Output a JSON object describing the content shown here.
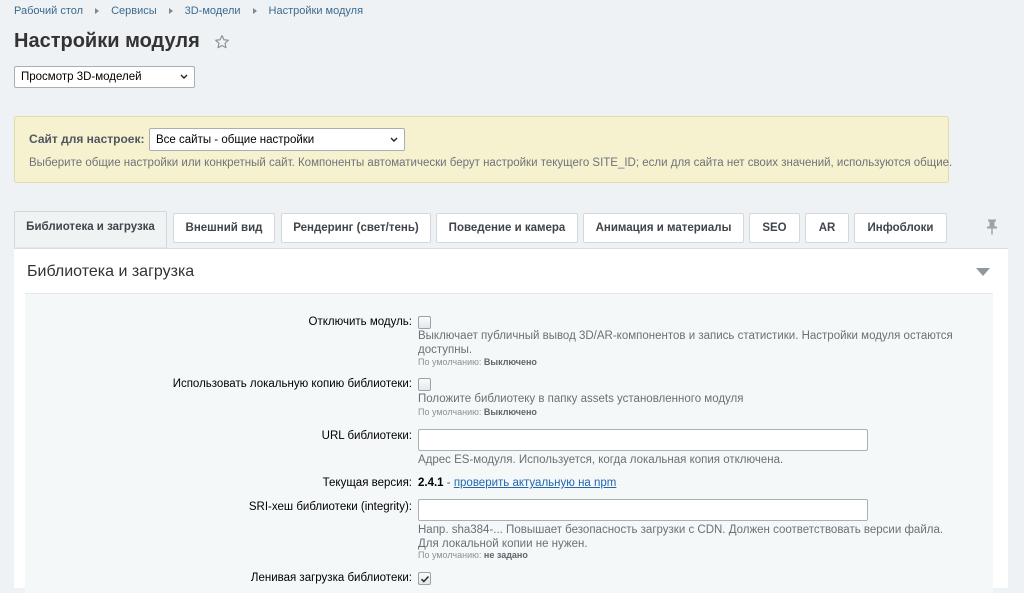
{
  "breadcrumb": [
    "Рабочий стол",
    "Сервисы",
    "3D-модели",
    "Настройки модуля"
  ],
  "page": {
    "title": "Настройки модуля"
  },
  "module_select": {
    "value": "Просмотр 3D-моделей"
  },
  "site": {
    "label": "Сайт для настроек:",
    "value": "Все сайты - общие настройки",
    "hint": "Выберите общие настройки или конкретный сайт. Компоненты автоматически берут настройки текущего SITE_ID; если для сайта нет своих значений, используются общие."
  },
  "tabs": [
    "Библиотека и загрузка",
    "Внешний вид",
    "Рендеринг (свет/тень)",
    "Поведение и камера",
    "Анимация и материалы",
    "SEO",
    "AR",
    "Инфоблоки"
  ],
  "section": {
    "title": "Библиотека и загрузка"
  },
  "fields": {
    "disable": {
      "label": "Отключить модуль:",
      "desc": "Выключает публичный вывод 3D/AR-компонентов и запись статистики. Настройки модуля остаются доступны.",
      "default_label": "По умолчанию:",
      "default_value": "Выключено"
    },
    "local_copy": {
      "label": "Использовать локальную копию библиотеки:",
      "desc": "Положите библиотеку в папку assets установленного модуля",
      "default_label": "По умолчанию:",
      "default_value": "Выключено"
    },
    "url": {
      "label": "URL библиотеки:",
      "value": "",
      "desc": "Адрес ES-модуля. Используется, когда локальная копия отключена."
    },
    "version": {
      "label": "Текущая версия:",
      "value": "2.4.1",
      "sep": " - ",
      "link": "проверить актуальную на npm"
    },
    "sri": {
      "label": "SRI-хеш библиотеки (integrity):",
      "value": "",
      "desc": "Напр. sha384-... Повышает безопасность загрузки с CDN. Должен соответствовать версии файла. Для локальной копии не нужен.",
      "default_label": "По умолчанию:",
      "default_value": "не задано"
    },
    "lazy": {
      "label": "Ленивая загрузка библиотеки:"
    }
  },
  "colors": {
    "background": "#eef2f4",
    "notice": "#f6f1cf",
    "link": "#2067b0"
  },
  "icons": [
    "star-icon",
    "chevron-down-icon",
    "pin-icon",
    "collapse-triangle-icon",
    "check-icon"
  ]
}
